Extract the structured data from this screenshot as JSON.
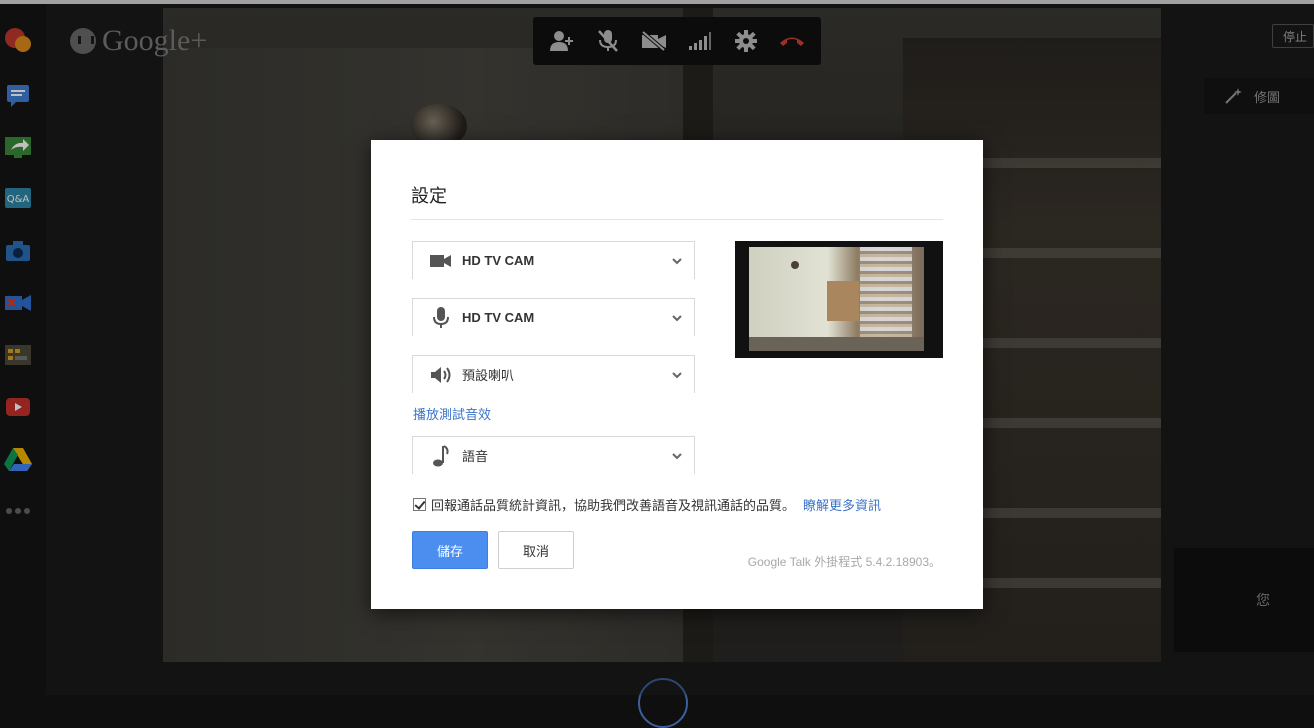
{
  "app": {
    "brand": "Google+",
    "stop_button_label": "停止",
    "retouch_label": "修圖",
    "self_label": "您"
  },
  "sidebar": {
    "items": [
      {
        "name": "hangouts-logo-icon"
      },
      {
        "name": "chat-icon"
      },
      {
        "name": "screenshare-icon"
      },
      {
        "name": "qa-icon",
        "label": "Q&A"
      },
      {
        "name": "camera-icon"
      },
      {
        "name": "remote-desktop-icon"
      },
      {
        "name": "cacoo-icon"
      },
      {
        "name": "youtube-icon"
      },
      {
        "name": "drive-icon"
      },
      {
        "name": "more-icon"
      }
    ]
  },
  "toolbar": {
    "buttons": [
      {
        "name": "invite-icon"
      },
      {
        "name": "mute-mic-icon"
      },
      {
        "name": "camera-off-icon"
      },
      {
        "name": "bandwidth-icon"
      },
      {
        "name": "gear-icon"
      },
      {
        "name": "hangup-icon",
        "color": "#d23f31"
      }
    ]
  },
  "dialog": {
    "title": "設定",
    "camera_select": {
      "value": "HD TV CAM",
      "icon": "video-camera-icon"
    },
    "mic_select": {
      "value": "HD TV CAM",
      "icon": "microphone-icon"
    },
    "speaker_select": {
      "value": "預設喇叭",
      "icon": "speaker-icon"
    },
    "test_sound_link": "播放測試音效",
    "ringtone_select": {
      "value": "語音",
      "icon": "music-note-icon"
    },
    "report_checkbox": {
      "checked": true,
      "label": "回報通話品質統計資訊，協助我們改善語音及視訊通話的品質。",
      "link": "瞭解更多資訊"
    },
    "save_label": "儲存",
    "cancel_label": "取消",
    "version_text": "Google Talk 外掛程式 5.4.2.18903。"
  },
  "colors": {
    "accent": "#4b8ef0",
    "link": "#3a74c9",
    "hangup": "#d23f31"
  }
}
